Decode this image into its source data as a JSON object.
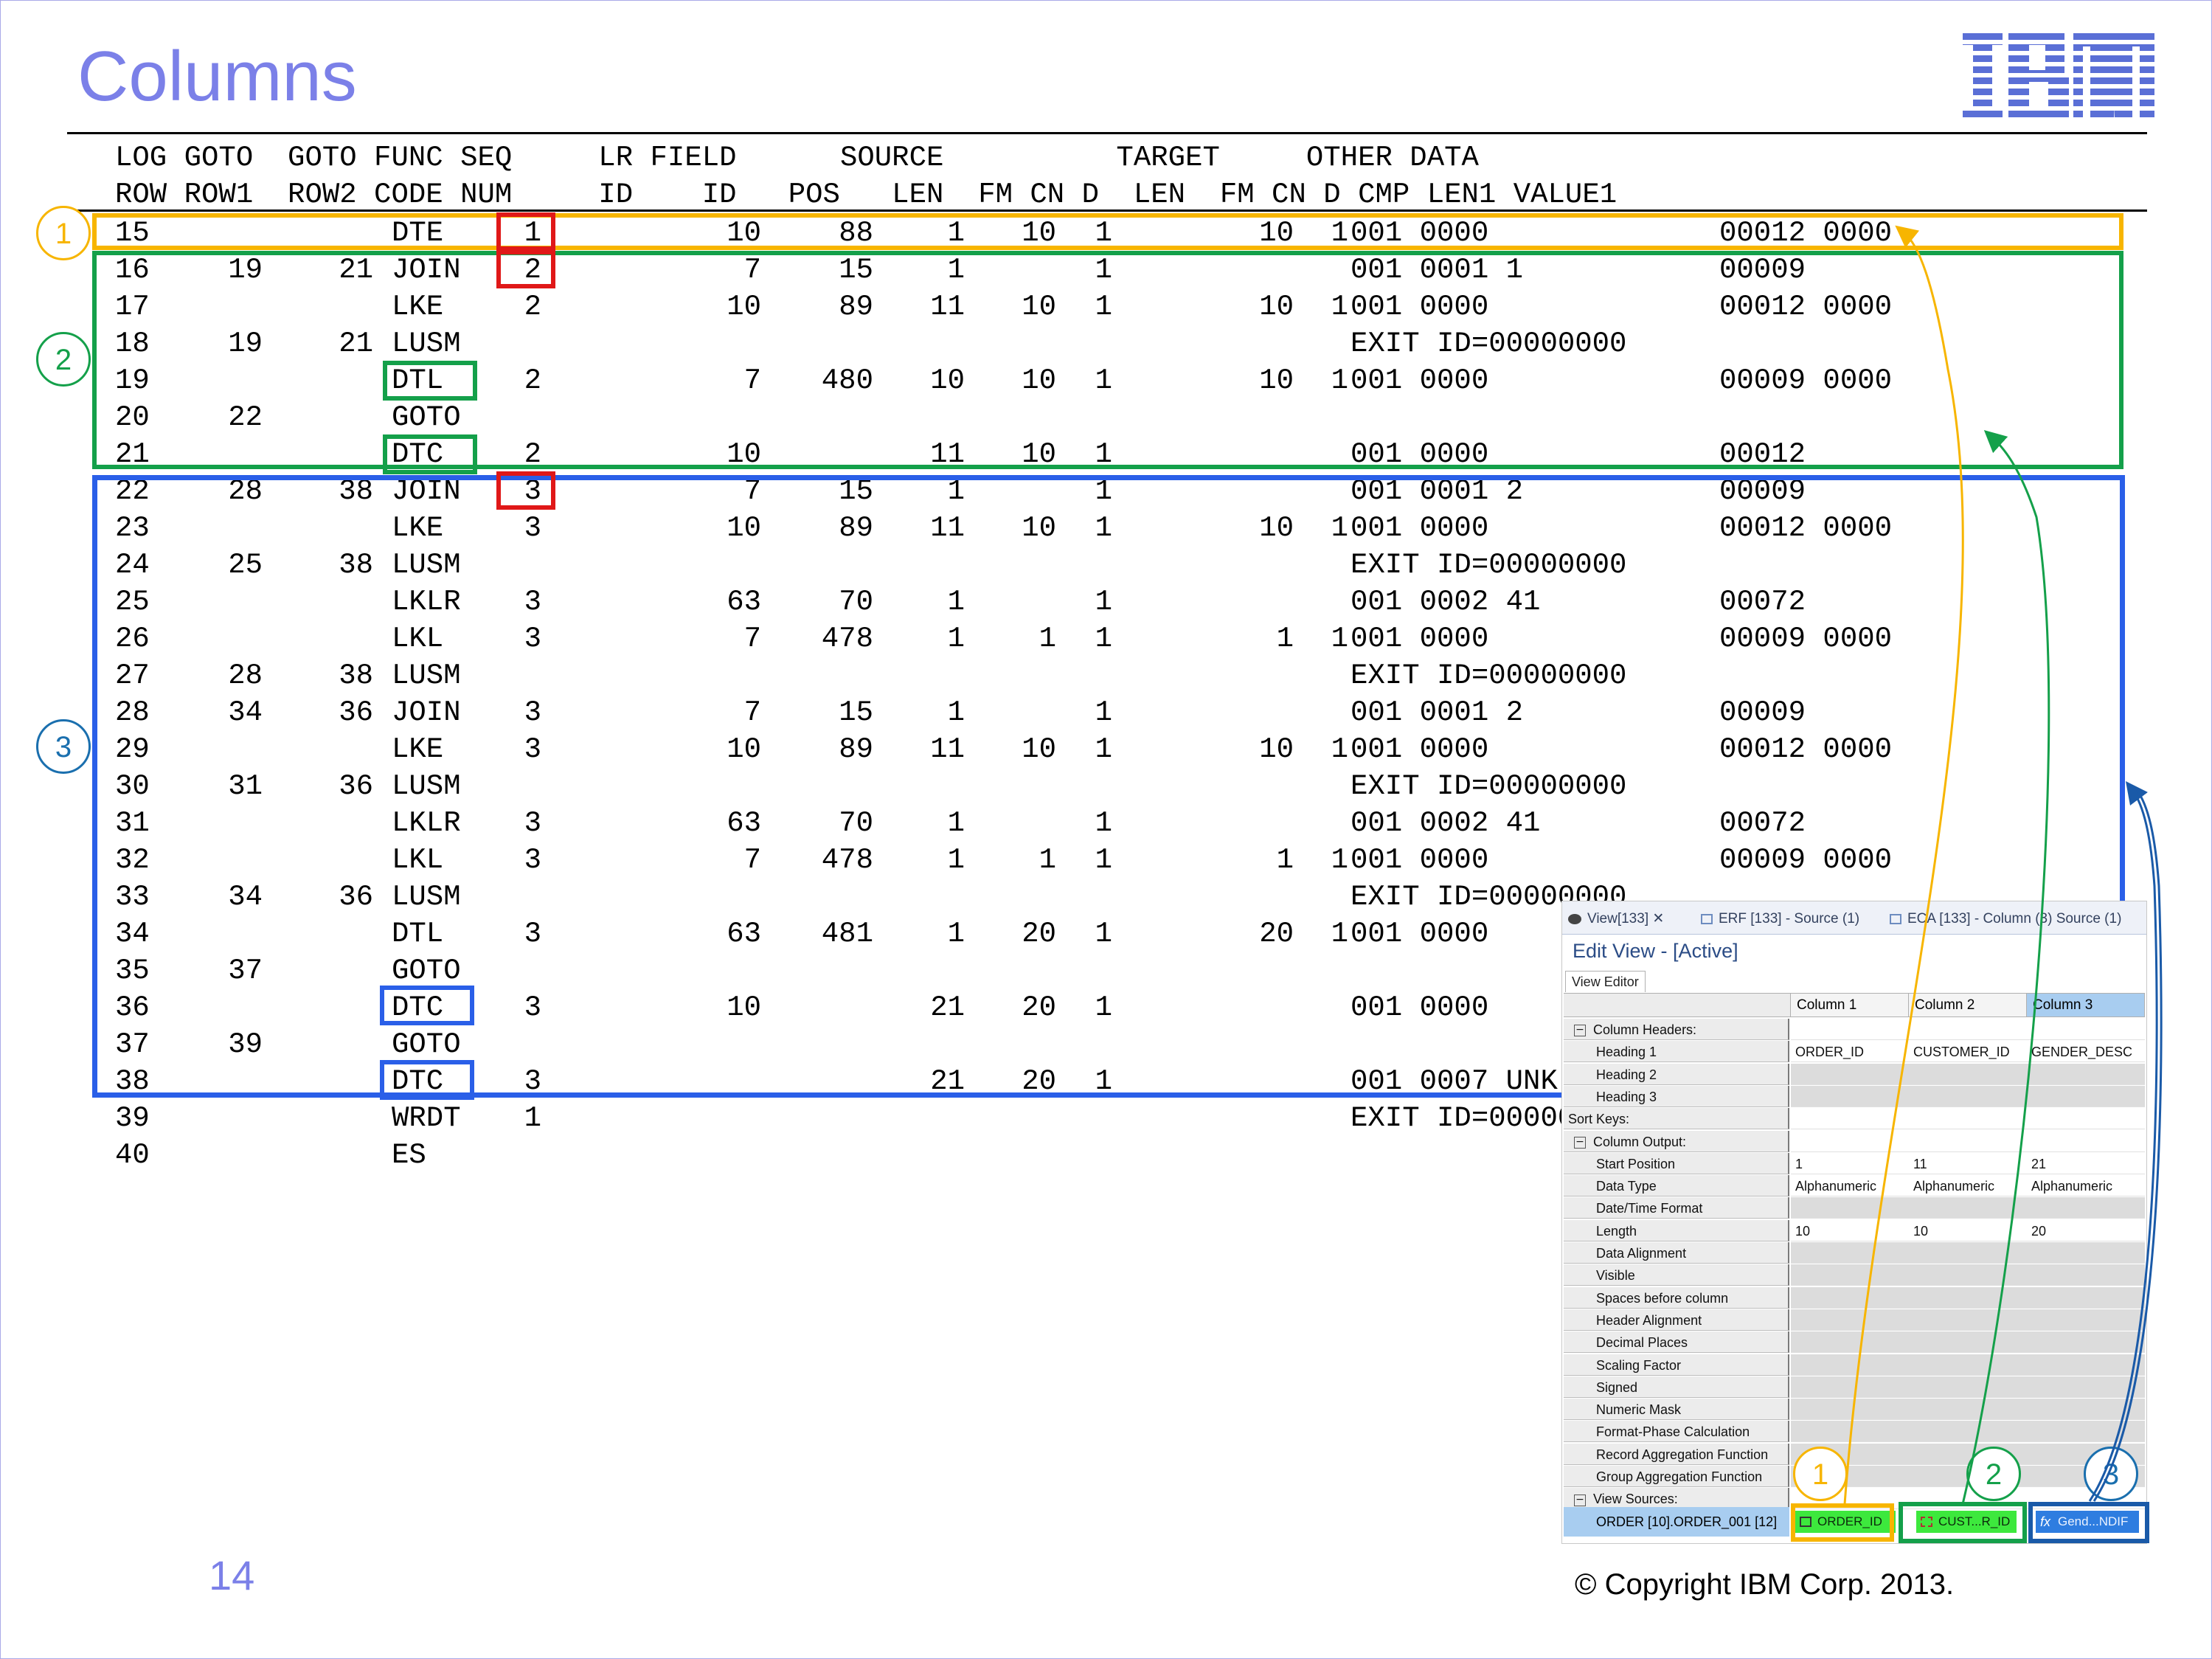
{
  "slide": {
    "title": "Columns",
    "logo_text": "IBM",
    "page_number": "14",
    "copyright": "© Copyright IBM Corp. 2013."
  },
  "table": {
    "header_line1": "LOG GOTO  GOTO FUNC SEQ     LR FIELD      SOURCE          TARGET     OTHER DATA",
    "header_line2": "ROW ROW1  ROW2 CODE NUM     ID    ID   POS   LEN  FM CN D  LEN  FM CN D CMP LEN1 VALUE1",
    "rows": [
      {
        "log": "15",
        "g1": "",
        "g2": "",
        "func": "DTE",
        "seq": "1",
        "lr": "10",
        "fid": "88",
        "pos": "1",
        "slen": "10",
        "sfm": "1",
        "tlen": "10",
        "tfm": "1",
        "cmp": "001 0000",
        "val": "00012 0000"
      },
      {
        "log": "16",
        "g1": "19",
        "g2": "21",
        "func": "JOIN",
        "seq": "2",
        "lr": "7",
        "fid": "15",
        "pos": "1",
        "slen": "",
        "sfm": "1",
        "tlen": "",
        "tfm": "",
        "cmp": "001 0001 1",
        "val": "00009"
      },
      {
        "log": "17",
        "g1": "",
        "g2": "",
        "func": "LKE",
        "seq": "2",
        "lr": "10",
        "fid": "89",
        "pos": "11",
        "slen": "10",
        "sfm": "1",
        "tlen": "10",
        "tfm": "1",
        "cmp": "001 0000",
        "val": "00012 0000"
      },
      {
        "log": "18",
        "g1": "19",
        "g2": "21",
        "func": "LUSM",
        "seq": "",
        "lr": "",
        "fid": "",
        "pos": "",
        "slen": "",
        "sfm": "",
        "tlen": "",
        "tfm": "",
        "cmp": "EXIT ID=00000000",
        "val": ""
      },
      {
        "log": "19",
        "g1": "",
        "g2": "",
        "func": "DTL",
        "seq": "2",
        "lr": "7",
        "fid": "480",
        "pos": "10",
        "slen": "10",
        "sfm": "1",
        "tlen": "10",
        "tfm": "1",
        "cmp": "001 0000",
        "val": "00009 0000"
      },
      {
        "log": "20",
        "g1": "22",
        "g2": "",
        "func": "GOTO",
        "seq": "",
        "lr": "",
        "fid": "",
        "pos": "",
        "slen": "",
        "sfm": "",
        "tlen": "",
        "tfm": "",
        "cmp": "",
        "val": ""
      },
      {
        "log": "21",
        "g1": "",
        "g2": "",
        "func": "DTC",
        "seq": "2",
        "lr": "10",
        "fid": "",
        "pos": "11",
        "slen": "10",
        "sfm": "1",
        "tlen": "",
        "tfm": "",
        "cmp": "001 0000",
        "val": "00012"
      },
      {
        "log": "22",
        "g1": "28",
        "g2": "38",
        "func": "JOIN",
        "seq": "3",
        "lr": "7",
        "fid": "15",
        "pos": "1",
        "slen": "",
        "sfm": "1",
        "tlen": "",
        "tfm": "",
        "cmp": "001 0001 2",
        "val": "00009"
      },
      {
        "log": "23",
        "g1": "",
        "g2": "",
        "func": "LKE",
        "seq": "3",
        "lr": "10",
        "fid": "89",
        "pos": "11",
        "slen": "10",
        "sfm": "1",
        "tlen": "10",
        "tfm": "1",
        "cmp": "001 0000",
        "val": "00012 0000"
      },
      {
        "log": "24",
        "g1": "25",
        "g2": "38",
        "func": "LUSM",
        "seq": "",
        "lr": "",
        "fid": "",
        "pos": "",
        "slen": "",
        "sfm": "",
        "tlen": "",
        "tfm": "",
        "cmp": "EXIT ID=00000000",
        "val": ""
      },
      {
        "log": "25",
        "g1": "",
        "g2": "",
        "func": "LKLR",
        "seq": "3",
        "lr": "63",
        "fid": "70",
        "pos": "1",
        "slen": "",
        "sfm": "1",
        "tlen": "",
        "tfm": "",
        "cmp": "001 0002 41",
        "val": "00072"
      },
      {
        "log": "26",
        "g1": "",
        "g2": "",
        "func": "LKL",
        "seq": "3",
        "lr": "7",
        "fid": "478",
        "pos": "1",
        "slen": "1",
        "sfm": "1",
        "tlen": "1",
        "tfm": "1",
        "cmp": "001 0000",
        "val": "00009 0000"
      },
      {
        "log": "27",
        "g1": "28",
        "g2": "38",
        "func": "LUSM",
        "seq": "",
        "lr": "",
        "fid": "",
        "pos": "",
        "slen": "",
        "sfm": "",
        "tlen": "",
        "tfm": "",
        "cmp": "EXIT ID=00000000",
        "val": ""
      },
      {
        "log": "28",
        "g1": "34",
        "g2": "36",
        "func": "JOIN",
        "seq": "3",
        "lr": "7",
        "fid": "15",
        "pos": "1",
        "slen": "",
        "sfm": "1",
        "tlen": "",
        "tfm": "",
        "cmp": "001 0001 2",
        "val": "00009"
      },
      {
        "log": "29",
        "g1": "",
        "g2": "",
        "func": "LKE",
        "seq": "3",
        "lr": "10",
        "fid": "89",
        "pos": "11",
        "slen": "10",
        "sfm": "1",
        "tlen": "10",
        "tfm": "1",
        "cmp": "001 0000",
        "val": "00012 0000"
      },
      {
        "log": "30",
        "g1": "31",
        "g2": "36",
        "func": "LUSM",
        "seq": "",
        "lr": "",
        "fid": "",
        "pos": "",
        "slen": "",
        "sfm": "",
        "tlen": "",
        "tfm": "",
        "cmp": "EXIT ID=00000000",
        "val": ""
      },
      {
        "log": "31",
        "g1": "",
        "g2": "",
        "func": "LKLR",
        "seq": "3",
        "lr": "63",
        "fid": "70",
        "pos": "1",
        "slen": "",
        "sfm": "1",
        "tlen": "",
        "tfm": "",
        "cmp": "001 0002 41",
        "val": "00072"
      },
      {
        "log": "32",
        "g1": "",
        "g2": "",
        "func": "LKL",
        "seq": "3",
        "lr": "7",
        "fid": "478",
        "pos": "1",
        "slen": "1",
        "sfm": "1",
        "tlen": "1",
        "tfm": "1",
        "cmp": "001 0000",
        "val": "00009 0000"
      },
      {
        "log": "33",
        "g1": "34",
        "g2": "36",
        "func": "LUSM",
        "seq": "",
        "lr": "",
        "fid": "",
        "pos": "",
        "slen": "",
        "sfm": "",
        "tlen": "",
        "tfm": "",
        "cmp": "EXIT ID=00000000",
        "val": ""
      },
      {
        "log": "34",
        "g1": "",
        "g2": "",
        "func": "DTL",
        "seq": "3",
        "lr": "63",
        "fid": "481",
        "pos": "1",
        "slen": "20",
        "sfm": "1",
        "tlen": "20",
        "tfm": "1",
        "cmp": "001 0000",
        "val": ""
      },
      {
        "log": "35",
        "g1": "37",
        "g2": "",
        "func": "GOTO",
        "seq": "",
        "lr": "",
        "fid": "",
        "pos": "",
        "slen": "",
        "sfm": "",
        "tlen": "",
        "tfm": "",
        "cmp": "",
        "val": ""
      },
      {
        "log": "36",
        "g1": "",
        "g2": "",
        "func": "DTC",
        "seq": "3",
        "lr": "10",
        "fid": "",
        "pos": "21",
        "slen": "20",
        "sfm": "1",
        "tlen": "",
        "tfm": "",
        "cmp": "001 0000",
        "val": ""
      },
      {
        "log": "37",
        "g1": "39",
        "g2": "",
        "func": "GOTO",
        "seq": "",
        "lr": "",
        "fid": "",
        "pos": "",
        "slen": "",
        "sfm": "",
        "tlen": "",
        "tfm": "",
        "cmp": "",
        "val": ""
      },
      {
        "log": "38",
        "g1": "",
        "g2": "",
        "func": "DTC",
        "seq": "3",
        "lr": "",
        "fid": "",
        "pos": "21",
        "slen": "20",
        "sfm": "1",
        "tlen": "",
        "tfm": "",
        "cmp": "001 0007 UNK",
        "val": ""
      },
      {
        "log": "39",
        "g1": "",
        "g2": "",
        "func": "WRDT",
        "seq": "1",
        "lr": "",
        "fid": "",
        "pos": "",
        "slen": "",
        "sfm": "",
        "tlen": "",
        "tfm": "",
        "cmp": "EXIT ID=00000000",
        "val": ""
      },
      {
        "log": "40",
        "g1": "",
        "g2": "",
        "func": "ES",
        "seq": "",
        "lr": "",
        "fid": "",
        "pos": "",
        "slen": "",
        "sfm": "",
        "tlen": "",
        "tfm": "",
        "cmp": "",
        "val": ""
      }
    ]
  },
  "callouts": {
    "labels": [
      "1",
      "2",
      "3"
    ],
    "colors": {
      "one": "#f7b500",
      "two": "#14a04a",
      "three": "#2a5fe8",
      "seq_highlight": "#e01818",
      "two_dark": "#0f7a35",
      "three_dark": "#1a5aa8"
    }
  },
  "editor": {
    "tabs": [
      "View[133]",
      "ERF [133] - Source (1)",
      "ECA [133] - Column (3) Source (1)"
    ],
    "title": "Edit View - [Active]",
    "subtab": "View Editor",
    "columns": [
      "Column 1",
      "Column 2",
      "Column 3"
    ],
    "rows": [
      {
        "label": "Column Headers:",
        "type": "group",
        "values": [
          "",
          "",
          ""
        ]
      },
      {
        "label": "Heading 1",
        "type": "item",
        "values": [
          "ORDER_ID",
          "CUSTOMER_ID",
          "GENDER_DESC"
        ]
      },
      {
        "label": "Heading 2",
        "type": "item",
        "values": [
          "",
          "",
          ""
        ]
      },
      {
        "label": "Heading 3",
        "type": "item",
        "values": [
          "",
          "",
          ""
        ]
      },
      {
        "label": "Sort Keys:",
        "type": "plain",
        "values": [
          "",
          "",
          ""
        ]
      },
      {
        "label": "Column Output:",
        "type": "group",
        "values": [
          "",
          "",
          ""
        ]
      },
      {
        "label": "Start Position",
        "type": "item",
        "values": [
          "1",
          "11",
          "21"
        ]
      },
      {
        "label": "Data Type",
        "type": "item",
        "values": [
          "Alphanumeric",
          "Alphanumeric",
          "Alphanumeric"
        ]
      },
      {
        "label": "Date/Time Format",
        "type": "item",
        "values": [
          "",
          "",
          ""
        ]
      },
      {
        "label": "Length",
        "type": "item",
        "values": [
          "10",
          "10",
          "20"
        ]
      },
      {
        "label": "Data Alignment",
        "type": "item",
        "values": [
          "",
          "",
          ""
        ]
      },
      {
        "label": "Visible",
        "type": "item",
        "values": [
          "",
          "",
          ""
        ]
      },
      {
        "label": "Spaces before column",
        "type": "item",
        "values": [
          "",
          "",
          ""
        ]
      },
      {
        "label": "Header Alignment",
        "type": "item",
        "values": [
          "",
          "",
          ""
        ]
      },
      {
        "label": "Decimal Places",
        "type": "item",
        "values": [
          "",
          "",
          ""
        ]
      },
      {
        "label": "Scaling Factor",
        "type": "item",
        "values": [
          "",
          "",
          ""
        ]
      },
      {
        "label": "Signed",
        "type": "item",
        "values": [
          "",
          "",
          ""
        ]
      },
      {
        "label": "Numeric Mask",
        "type": "item",
        "values": [
          "",
          "",
          ""
        ]
      },
      {
        "label": "Format-Phase Calculation",
        "type": "item",
        "values": [
          "",
          "",
          ""
        ]
      },
      {
        "label": "Record Aggregation Function",
        "type": "item",
        "values": [
          "",
          "",
          ""
        ]
      },
      {
        "label": "Group Aggregation Function",
        "type": "item",
        "values": [
          "",
          "",
          ""
        ]
      },
      {
        "label": "View Sources:",
        "type": "group",
        "values": [
          "",
          "",
          ""
        ]
      }
    ],
    "view_source": {
      "label": "ORDER [10].ORDER_001 [12]",
      "chips": [
        "ORDER_ID",
        "CUST...R_ID",
        "Gend...NDIF"
      ]
    }
  }
}
